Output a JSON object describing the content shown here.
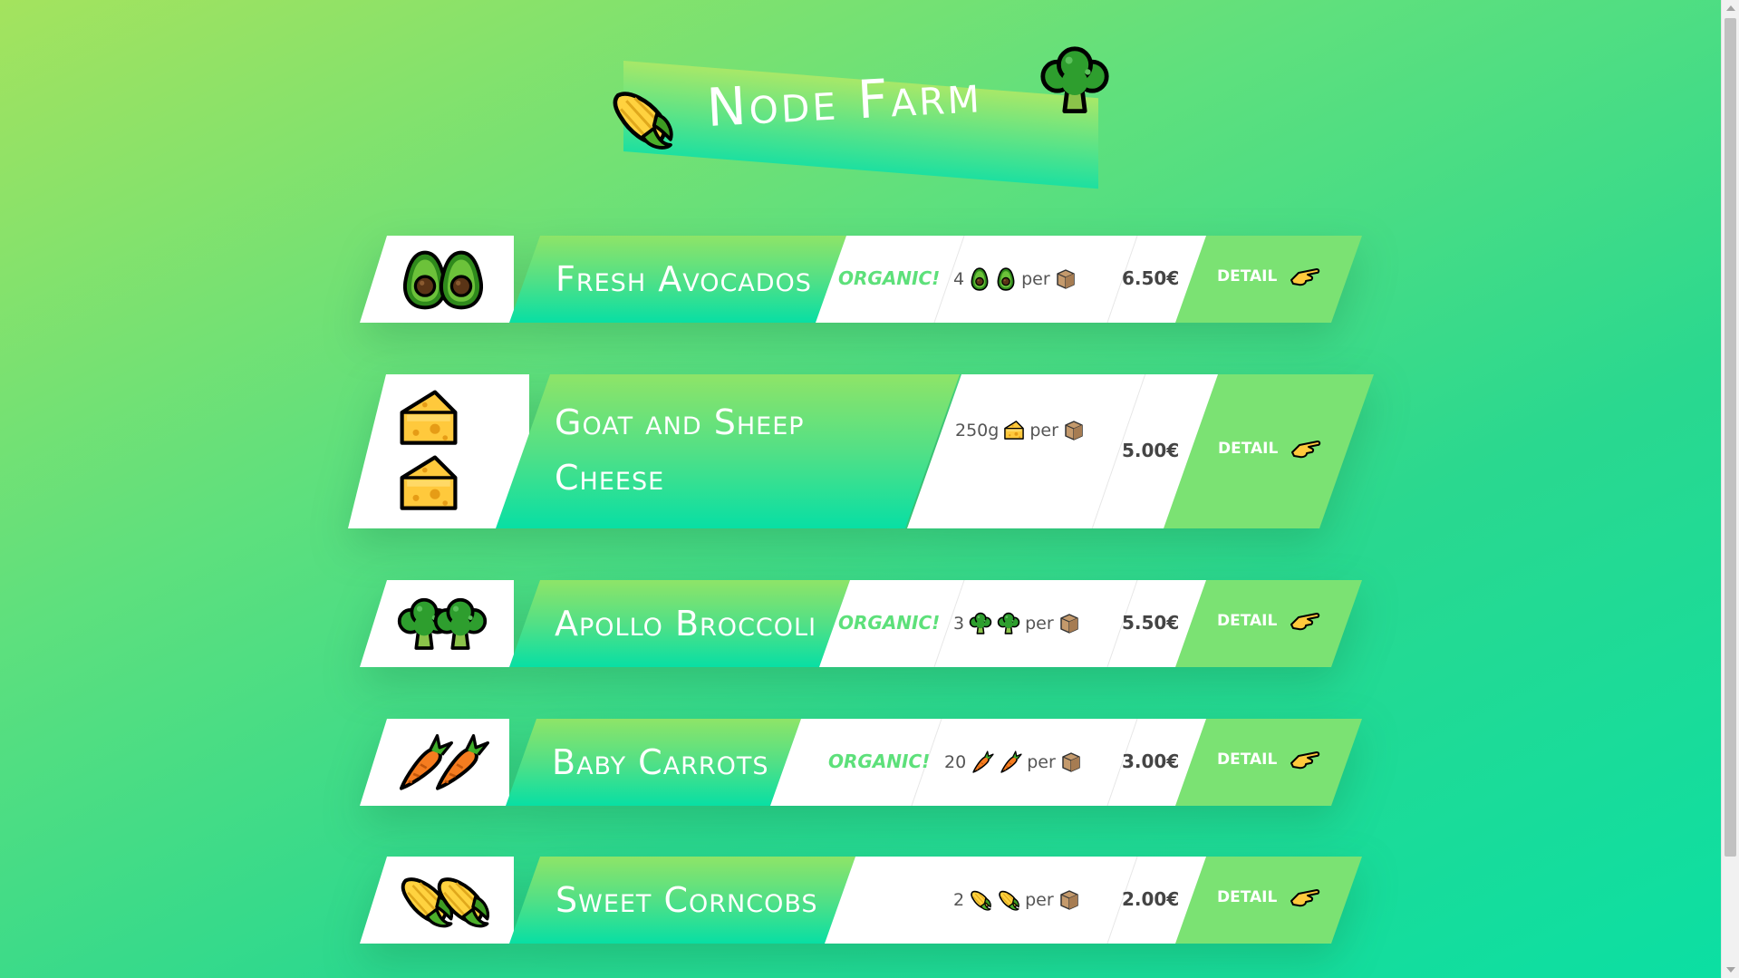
{
  "app": {
    "title": "Node Farm",
    "icons": [
      "corn-icon",
      "broccoli-icon"
    ]
  },
  "products": [
    {
      "image": "avocado",
      "name": "Fresh Avocados",
      "organic": "ORGANIC!",
      "quantity": "4",
      "per": "per",
      "price": "6.50€",
      "detail": "DETAIL"
    },
    {
      "image": "cheese",
      "name_line1": "Goat and Sheep",
      "name_line2": "Cheese",
      "organic": "",
      "quantity": "250g",
      "per": "per",
      "price": "5.00€",
      "detail": "DETAIL"
    },
    {
      "image": "broccoli",
      "name": "Apollo Broccoli",
      "organic": "ORGANIC!",
      "quantity": "3",
      "per": "per",
      "price": "5.50€",
      "detail": "DETAIL"
    },
    {
      "image": "carrot",
      "name": "Baby Carrots",
      "organic": "ORGANIC!",
      "quantity": "20",
      "per": "per",
      "price": "3.00€",
      "detail": "DETAIL"
    },
    {
      "image": "corn",
      "name": "Sweet Corncobs",
      "organic": "",
      "quantity": "2",
      "per": "per",
      "price": "2.00€",
      "detail": "DETAIL"
    }
  ],
  "colors": {
    "organic": "#5de07a",
    "detail_panel": "#7be273",
    "price": "#444444"
  }
}
